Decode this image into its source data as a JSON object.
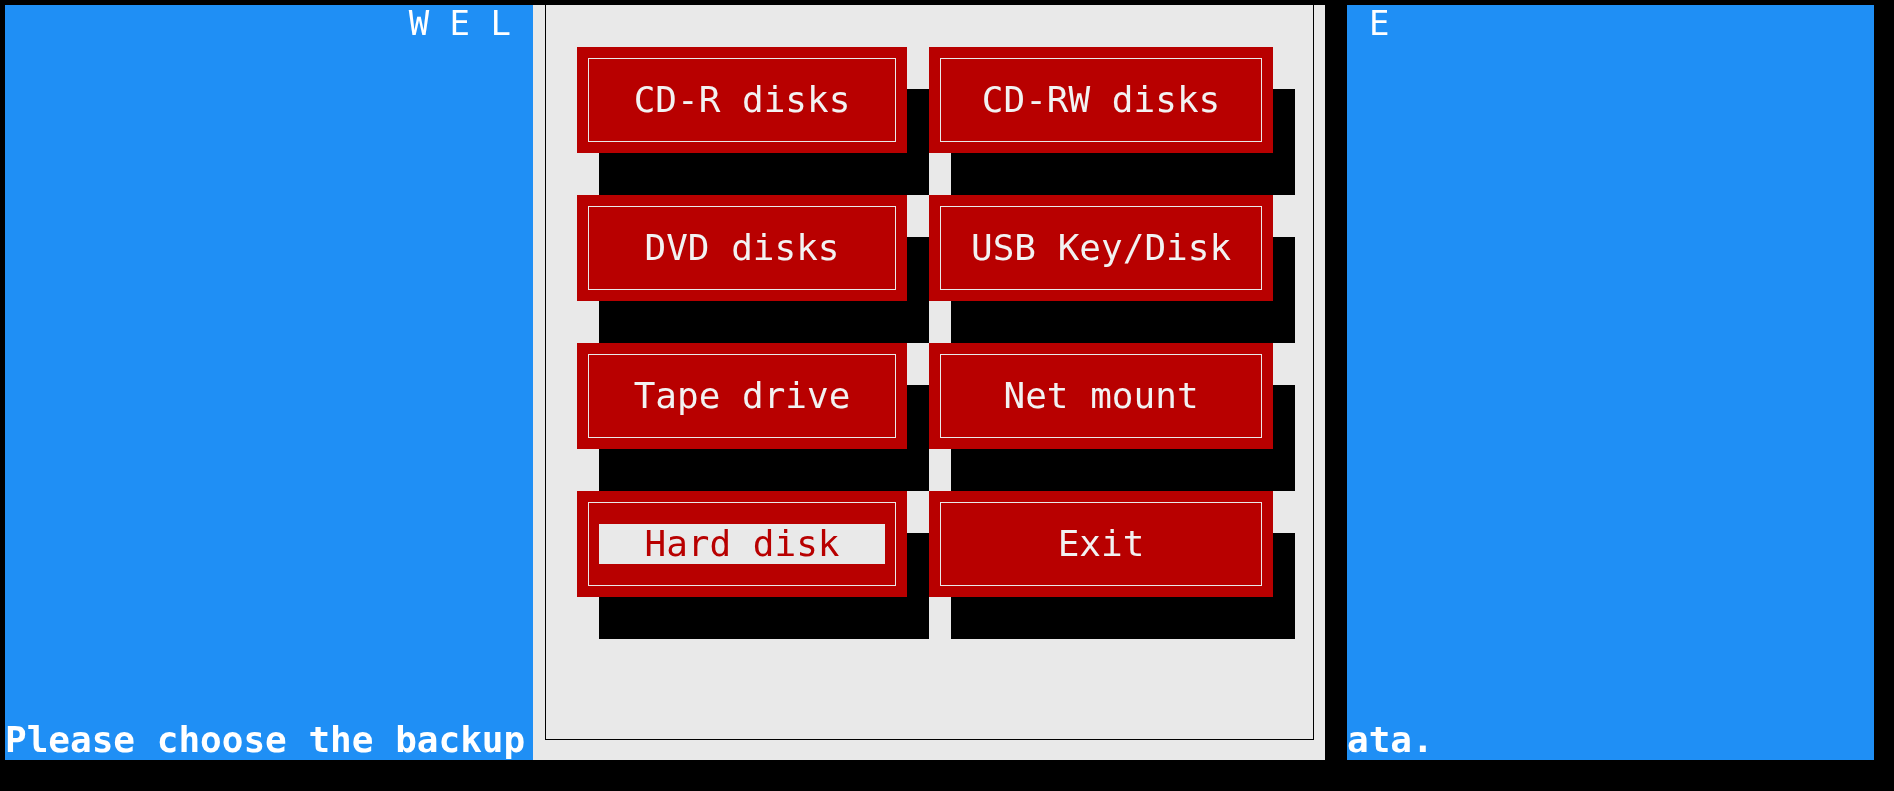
{
  "background_title_left": "W E L",
  "background_title_right": "E",
  "dialog": {
    "buttons": [
      {
        "label": "CD-R disks",
        "selected": false
      },
      {
        "label": "CD-RW disks",
        "selected": false
      },
      {
        "label": "DVD disks",
        "selected": false
      },
      {
        "label": "USB Key/Disk",
        "selected": false
      },
      {
        "label": "Tape drive",
        "selected": false
      },
      {
        "label": "Net mount",
        "selected": false
      },
      {
        "label": "Hard disk",
        "selected": true
      },
      {
        "label": "Exit",
        "selected": false
      }
    ]
  },
  "prompt_left": "Please choose the backup",
  "prompt_right": "ata."
}
